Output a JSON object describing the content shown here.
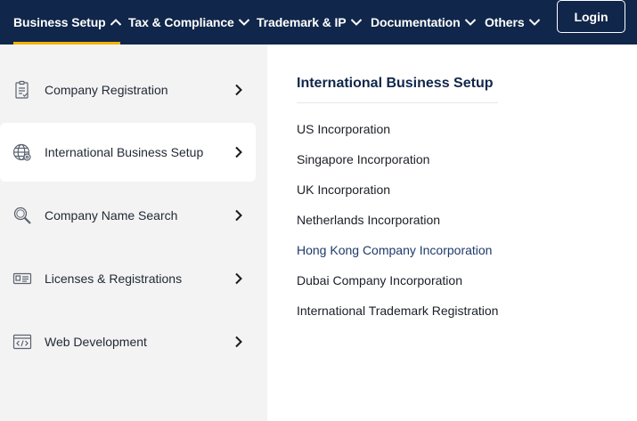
{
  "nav": {
    "items": [
      {
        "label": "Business Setup",
        "active": true
      },
      {
        "label": "Tax & Compliance"
      },
      {
        "label": "Trademark & IP"
      },
      {
        "label": "Documentation"
      },
      {
        "label": "Others"
      }
    ],
    "login_label": "Login"
  },
  "sidebar": {
    "items": [
      {
        "label": "Company Registration",
        "icon": "document-checklist-icon"
      },
      {
        "label": "International Business Setup",
        "icon": "globe-icon",
        "active": true
      },
      {
        "label": "Company Name Search",
        "icon": "magnifier-icon"
      },
      {
        "label": "Licenses & Registrations",
        "icon": "id-card-icon"
      },
      {
        "label": "Web Development",
        "icon": "code-window-icon"
      }
    ]
  },
  "panel": {
    "title": "International Business Setup",
    "links": [
      "US Incorporation",
      "Singapore Incorporation",
      "UK Incorporation",
      "Netherlands Incorporation",
      "Hong Kong Company Incorporation",
      "Dubai Company Incorporation",
      "International Trademark Registration"
    ]
  },
  "colors": {
    "navbar_bg": "#10264a",
    "active_underline": "#f2b300",
    "sidebar_bg": "#f3f3f3"
  }
}
